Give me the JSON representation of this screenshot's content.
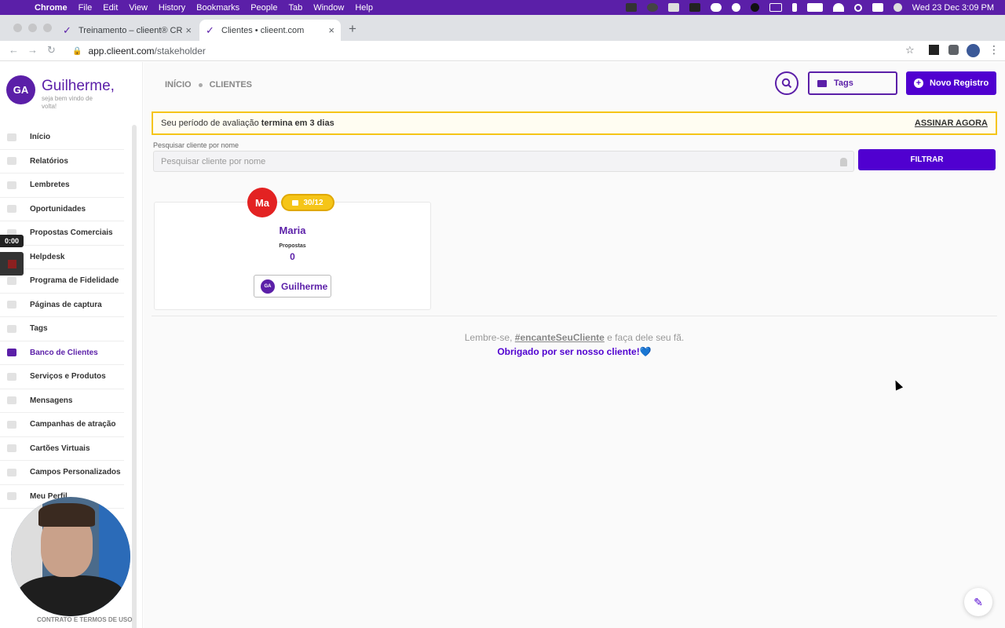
{
  "menubar": {
    "items": [
      "Chrome",
      "File",
      "Edit",
      "View",
      "History",
      "Bookmarks",
      "People",
      "Tab",
      "Window",
      "Help"
    ],
    "clock": "Wed 23 Dec  3:09 PM"
  },
  "browser": {
    "tabs": [
      {
        "title": "Treinamento – clieent® CRM"
      },
      {
        "title": "Clientes • clieent.com"
      }
    ],
    "url_host": "app.clieent.com",
    "url_path": "/stakeholder"
  },
  "sidebar": {
    "avatar_initials": "GA",
    "greeting": "Guilherme,",
    "welcome": "seja bem vindo de volta!",
    "items": [
      {
        "label": "Início"
      },
      {
        "label": "Relatórios"
      },
      {
        "label": "Lembretes"
      },
      {
        "label": "Oportunidades"
      },
      {
        "label": "Propostas Comerciais"
      },
      {
        "label": "Helpdesk"
      },
      {
        "label": "Programa de Fidelidade"
      },
      {
        "label": "Páginas de captura"
      },
      {
        "label": "Tags"
      },
      {
        "label": "Banco de Clientes"
      },
      {
        "label": "Serviços e Produtos"
      },
      {
        "label": "Mensagens"
      },
      {
        "label": "Campanhas de atração"
      },
      {
        "label": "Cartões Virtuais"
      },
      {
        "label": "Campos Personalizados"
      },
      {
        "label": "Meu Perfil"
      }
    ],
    "active_index": 9,
    "footer": "CONTRATO E TERMOS DE USO",
    "timer": "0:00"
  },
  "header": {
    "breadcrumb": [
      "INÍCIO",
      "CLIENTES"
    ],
    "tags_label": "Tags",
    "new_label": "Novo Registro"
  },
  "trial": {
    "text": "Seu período de avaliação",
    "bold": "termina em 3 dias",
    "cta": "ASSINAR AGORA"
  },
  "search": {
    "label": "Pesquisar cliente por nome",
    "placeholder": "Pesquisar cliente por nome",
    "button": "FILTRAR"
  },
  "client_card": {
    "initials": "Ma",
    "birthday": "30/12",
    "name": "Maria",
    "proposals_label": "Propostas",
    "proposals_value": "0",
    "owner_initials": "GA",
    "owner_name": "Guilherme"
  },
  "footer_message": {
    "pre": "Lembre-se,",
    "hashtag": "#encanteSeuCliente",
    "post": "e faça dele seu fã.",
    "thanks": "Obrigado por ser nosso cliente!",
    "heart": "💙"
  },
  "colors": {
    "brand": "#5b1fa8",
    "primary": "#5000d0",
    "warning": "#f5c518",
    "avatar_red": "#e32222"
  }
}
